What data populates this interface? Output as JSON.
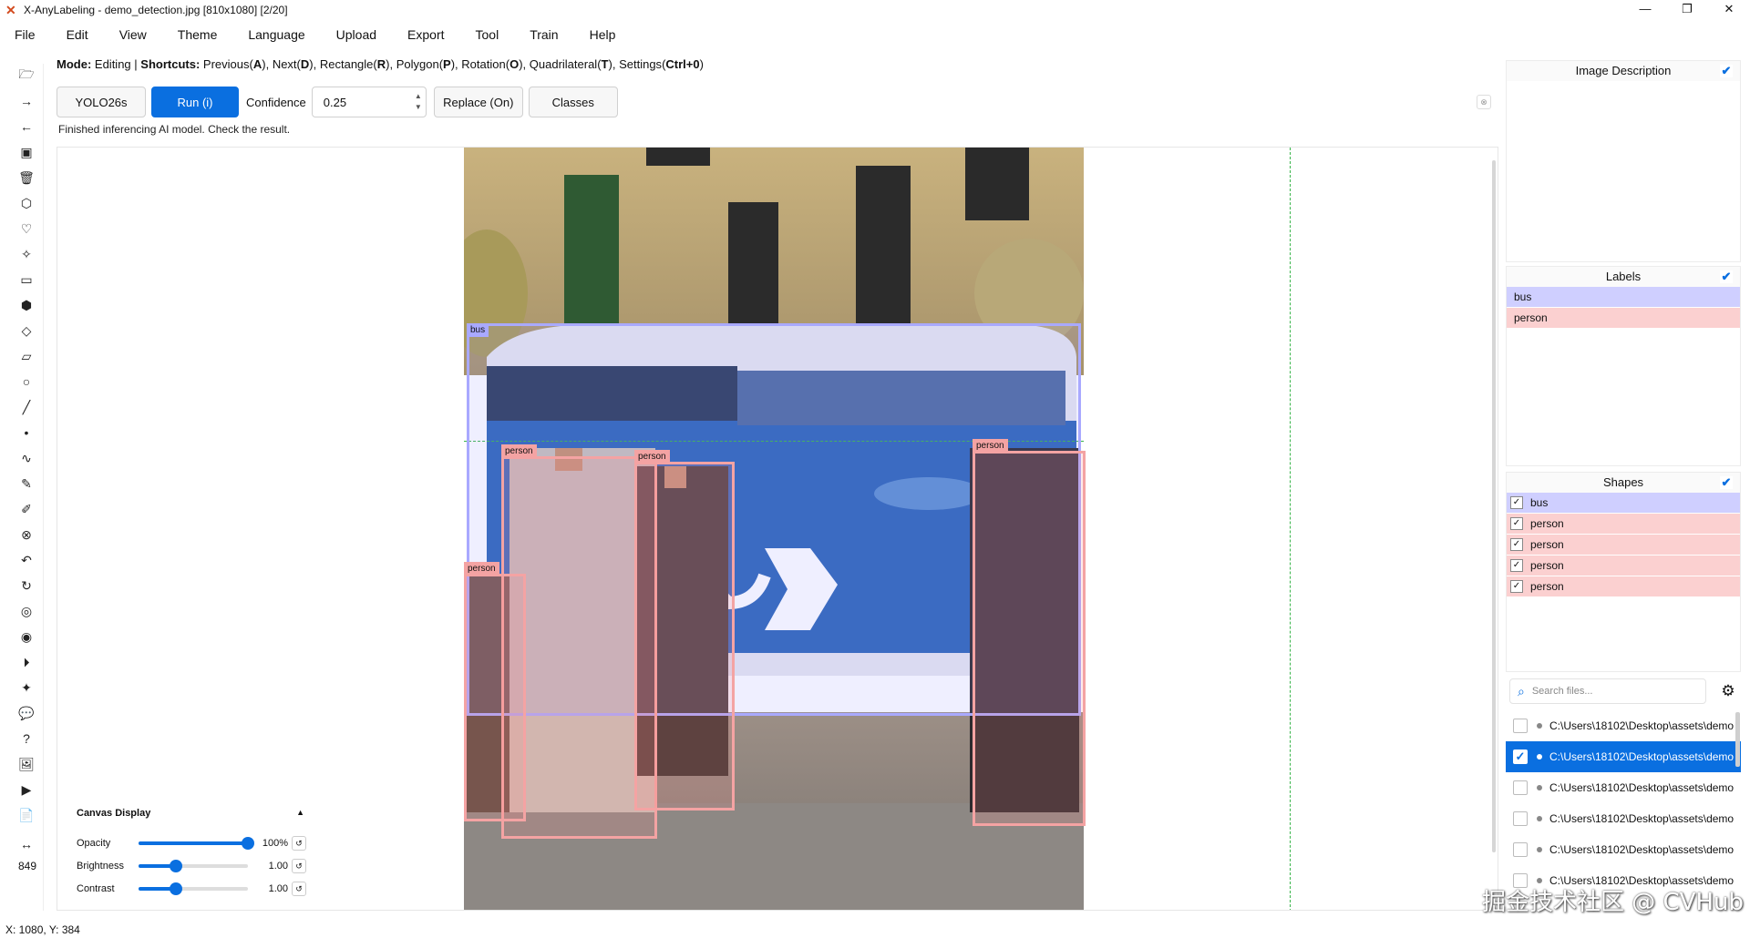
{
  "window": {
    "title": "X-AnyLabeling - demo_detection.jpg [810x1080] [2/20]",
    "minimize": "—",
    "maximize": "❐",
    "close": "✕"
  },
  "menu": [
    "File",
    "Edit",
    "View",
    "Theme",
    "Language",
    "Upload",
    "Export",
    "Tool",
    "Train",
    "Help"
  ],
  "mode": {
    "mode_label": "Mode:",
    "mode_value": "Editing",
    "sep": "|",
    "shortcuts_label": "Shortcuts:",
    "shortcuts": [
      {
        "name": "Previous",
        "key": "A"
      },
      {
        "name": "Next",
        "key": "D"
      },
      {
        "name": "Rectangle",
        "key": "R"
      },
      {
        "name": "Polygon",
        "key": "P"
      },
      {
        "name": "Rotation",
        "key": "O"
      },
      {
        "name": "Quadrilateral",
        "key": "T"
      },
      {
        "name": "Settings",
        "key": "Ctrl+0"
      }
    ]
  },
  "toolbar": {
    "model": "YOLO26s",
    "run": "Run (i)",
    "confidence_label": "Confidence",
    "confidence": "0.25",
    "replace": "Replace (On)",
    "classes": "Classes"
  },
  "status": "Finished inferencing AI model. Check the result.",
  "canvas": {
    "zoom": "849",
    "annotations": [
      {
        "label": "bus"
      },
      {
        "label": "person"
      },
      {
        "label": "person"
      },
      {
        "label": "person"
      },
      {
        "label": "person"
      }
    ]
  },
  "canvas_display": {
    "title": "Canvas Display",
    "opacity": {
      "label": "Opacity",
      "value": "100%",
      "level": 1.0
    },
    "brightness": {
      "label": "Brightness",
      "value": "1.00",
      "level": 0.34
    },
    "contrast": {
      "label": "Contrast",
      "value": "1.00",
      "level": 0.34
    }
  },
  "coords": "X: 1080, Y: 384",
  "panels": {
    "description": {
      "title": "Image Description"
    },
    "labels": {
      "title": "Labels",
      "items": [
        "bus",
        "person"
      ]
    },
    "shapes": {
      "title": "Shapes",
      "items": [
        "bus",
        "person",
        "person",
        "person",
        "person"
      ]
    }
  },
  "search": {
    "placeholder": "Search files..."
  },
  "files": [
    {
      "path": "C:\\Users\\18102\\Desktop\\assets\\demo",
      "selected": false
    },
    {
      "path": "C:\\Users\\18102\\Desktop\\assets\\demo",
      "selected": true
    },
    {
      "path": "C:\\Users\\18102\\Desktop\\assets\\demo",
      "selected": false
    },
    {
      "path": "C:\\Users\\18102\\Desktop\\assets\\demo",
      "selected": false
    },
    {
      "path": "C:\\Users\\18102\\Desktop\\assets\\demo",
      "selected": false
    },
    {
      "path": "C:\\Users\\18102\\Desktop\\assets\\demo",
      "selected": false
    }
  ],
  "watermark": "掘金技术社区 @ CVHub",
  "colors": {
    "accent": "#0a6fe0",
    "bus": "#a9a9ff",
    "person": "#f4a3a3",
    "guide": "#39b54a"
  }
}
